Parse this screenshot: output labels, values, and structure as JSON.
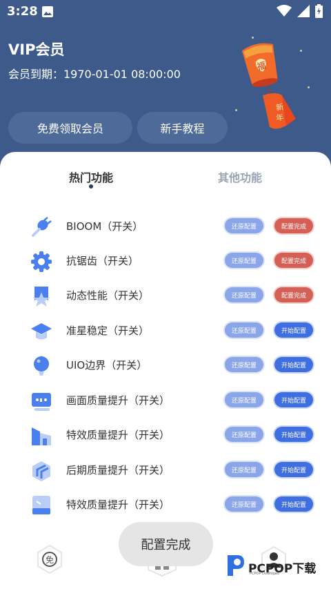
{
  "status_bar": {
    "time": "3:28"
  },
  "header": {
    "title": "VIP会员",
    "expiry": "会员到期：1970-01-01 08:00:00",
    "free_button": "免费领取会员",
    "tutorial_button": "新手教程"
  },
  "tabs": [
    {
      "label": "热门功能",
      "active": true
    },
    {
      "label": "其他功能",
      "active": false
    }
  ],
  "features": [
    {
      "label": "BIOOM（开关）",
      "icon": "plug-icon",
      "restore": "还原配置",
      "action": "配置完成",
      "state": "done"
    },
    {
      "label": "抗锯齿（开关）",
      "icon": "gear-icon",
      "restore": "还原配置",
      "action": "配置完成",
      "state": "done"
    },
    {
      "label": "动态性能（开关）",
      "icon": "star-badge-icon",
      "restore": "还原配置",
      "action": "配置完成",
      "state": "done"
    },
    {
      "label": "准星稳定（开关）",
      "icon": "graduation-cap-icon",
      "restore": "还原配置",
      "action": "开始配置",
      "state": "start"
    },
    {
      "label": "UIO边界（开关）",
      "icon": "balloon-icon",
      "restore": "还原配置",
      "action": "开始配置",
      "state": "start"
    },
    {
      "label": "画面质量提升（开关）",
      "icon": "screen-icon",
      "restore": "还原配置",
      "action": "开始配置",
      "state": "start"
    },
    {
      "label": "特效质量提升（开关）",
      "icon": "building-icon",
      "restore": "还原配置",
      "action": "开始配置",
      "state": "start"
    },
    {
      "label": "后期质量提升（开关）",
      "icon": "cube-icon",
      "restore": "还原配置",
      "action": "开始配置",
      "state": "start"
    },
    {
      "label": "特效质量提升（开关）",
      "icon": "card-icon",
      "restore": "还原配置",
      "action": "开始配置",
      "state": "start"
    }
  ],
  "bottom_nav": [
    {
      "icon": "free-badge-icon",
      "glyph": "免"
    },
    {
      "icon": "grid-icon"
    },
    {
      "icon": "user-icon"
    }
  ],
  "toast": "配置完成",
  "watermark": {
    "brand": "PCPOP下载",
    "sub": "PCPOP Download"
  },
  "colors": {
    "header_bg": "#3d5a8a",
    "restore_pill": "#8aa5e8",
    "done_pill": "#d45f54",
    "start_pill": "#3f6ee0",
    "icon_blue": "#4a7ff0"
  }
}
